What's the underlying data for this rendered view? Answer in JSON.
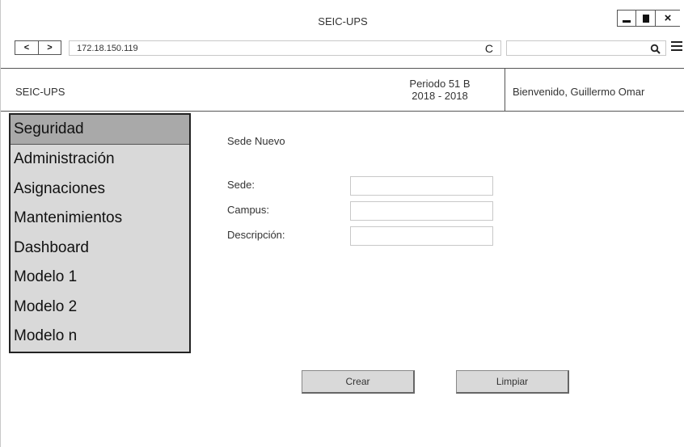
{
  "window": {
    "title": "SEIC-UPS",
    "controls": {
      "close": "×"
    }
  },
  "browser": {
    "back": "<",
    "forward": ">",
    "url": "172.18.150.119",
    "reload": "C",
    "search_value": ""
  },
  "app_header": {
    "app_name": "SEIC-UPS",
    "periodo_line1": "Periodo 51 B",
    "periodo_line2": "2018 - 2018",
    "welcome": "Bienvenido, Guillermo Omar"
  },
  "sidebar": {
    "items": [
      {
        "label": "Seguridad",
        "active": true
      },
      {
        "label": "Administración",
        "active": false
      },
      {
        "label": "Asignaciones",
        "active": false
      },
      {
        "label": "Mantenimientos",
        "active": false
      },
      {
        "label": "Dashboard",
        "active": false
      },
      {
        "label": "Modelo 1",
        "active": false
      },
      {
        "label": "Modelo 2",
        "active": false
      },
      {
        "label": "Modelo n",
        "active": false
      }
    ]
  },
  "form": {
    "title": "Sede Nuevo",
    "fields": [
      {
        "label": "Sede:",
        "value": ""
      },
      {
        "label": "Campus:",
        "value": ""
      },
      {
        "label": "Descripción:",
        "value": ""
      }
    ],
    "buttons": {
      "create": "Crear",
      "clear": "Limpiar"
    }
  },
  "colors": {
    "sidebar_bg": "#d9d9d9",
    "sidebar_active_bg": "#a9a9a9",
    "border": "#222222"
  }
}
